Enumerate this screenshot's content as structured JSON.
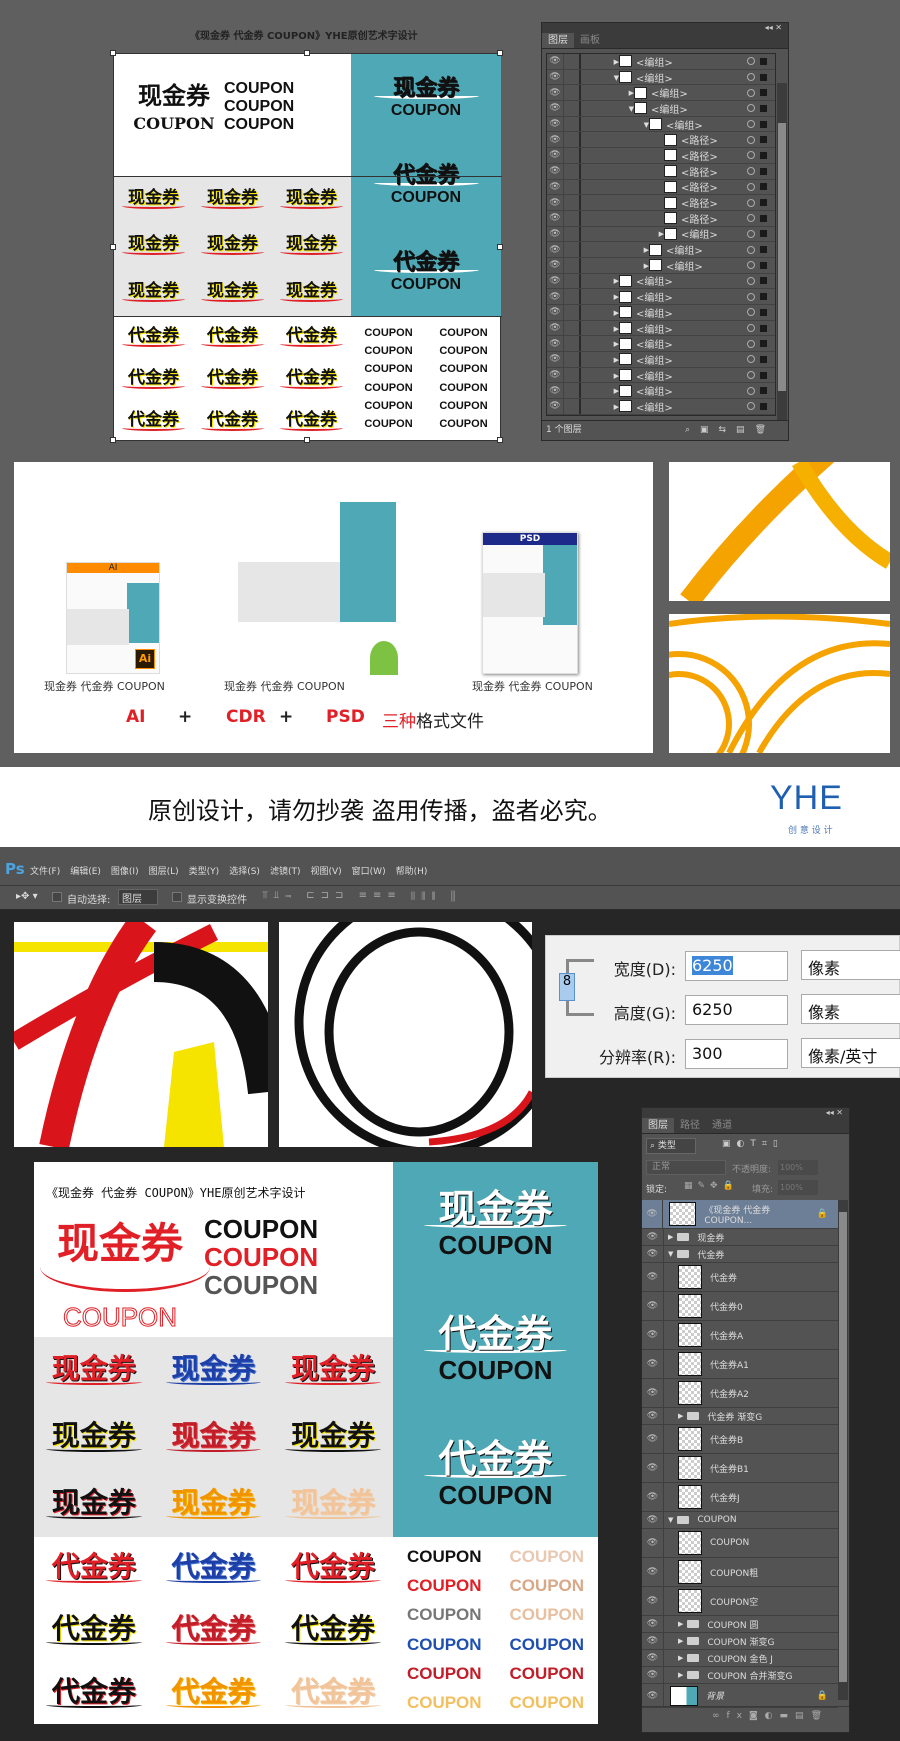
{
  "artboard": {
    "title": "《现金券 代金券 COUPON》YHE原创艺术字设计",
    "word_xian": "现金券",
    "word_dai": "代金券",
    "word_coupon": "COUPON",
    "teal": "#4fa8b5",
    "gray": "#e6e6e6"
  },
  "ai_layers": {
    "tabs": [
      "图层",
      "画板"
    ],
    "footer": "1 个图层",
    "rows": [
      {
        "indent": 0,
        "arrow": "▶",
        "label": "<编组>"
      },
      {
        "indent": 0,
        "arrow": "▼",
        "label": "<编组>"
      },
      {
        "indent": 1,
        "arrow": "▶",
        "label": "<编组>"
      },
      {
        "indent": 1,
        "arrow": "▼",
        "label": "<编组>"
      },
      {
        "indent": 2,
        "arrow": "▼",
        "label": "<编组>"
      },
      {
        "indent": 3,
        "arrow": "",
        "label": "<路径>"
      },
      {
        "indent": 3,
        "arrow": "",
        "label": "<路径>"
      },
      {
        "indent": 3,
        "arrow": "",
        "label": "<路径>"
      },
      {
        "indent": 3,
        "arrow": "",
        "label": "<路径>"
      },
      {
        "indent": 3,
        "arrow": "",
        "label": "<路径>"
      },
      {
        "indent": 3,
        "arrow": "",
        "label": "<路径>"
      },
      {
        "indent": 3,
        "arrow": "▶",
        "label": "<编组>"
      },
      {
        "indent": 2,
        "arrow": "▶",
        "label": "<编组>"
      },
      {
        "indent": 2,
        "arrow": "▶",
        "label": "<编组>"
      },
      {
        "indent": 0,
        "arrow": "▶",
        "label": "<编组>"
      },
      {
        "indent": 0,
        "arrow": "▶",
        "label": "<编组>"
      },
      {
        "indent": 0,
        "arrow": "▶",
        "label": "<编组>"
      },
      {
        "indent": 0,
        "arrow": "▶",
        "label": "<编组>"
      },
      {
        "indent": 0,
        "arrow": "▶",
        "label": "<编组>"
      },
      {
        "indent": 0,
        "arrow": "▶",
        "label": "<编组>"
      },
      {
        "indent": 0,
        "arrow": "▶",
        "label": "<编组>"
      },
      {
        "indent": 0,
        "arrow": "▶",
        "label": "<编组>"
      },
      {
        "indent": 0,
        "arrow": "▶",
        "label": "<编组>"
      }
    ]
  },
  "formats": {
    "caption": "现金券 代金券 COUPON",
    "ai_badge": "AI",
    "psd_badge": "PSD",
    "ai_logo": "Ai",
    "row": {
      "ai": "AI",
      "plus": "+",
      "cdr": "CDR",
      "psd": "PSD",
      "three": "三种",
      "rest": "格式文件"
    },
    "ai_color": "#ff8c00",
    "psd_color": "#1e2a8a",
    "red": "#e01f26"
  },
  "banner": {
    "text": "原创设计，请勿抄袭 盗用传播，盗者必究。",
    "logo": "YHE",
    "logo_sub": "创 意 设 计"
  },
  "photoshop": {
    "logo": "Ps",
    "menu": [
      "文件(F)",
      "编辑(E)",
      "图像(I)",
      "图层(L)",
      "类型(Y)",
      "选择(S)",
      "滤镜(T)",
      "视图(V)",
      "窗口(W)",
      "帮助(H)"
    ],
    "auto_select_label": "自动选择:",
    "auto_select_value": "图层",
    "show_transform_label": "显示变换控件"
  },
  "image_size": {
    "width_label": "宽度(D):",
    "width_value": "6250",
    "width_unit": "像素",
    "height_label": "高度(G):",
    "height_value": "6250",
    "height_unit": "像素",
    "res_label": "分辨率(R):",
    "res_value": "300",
    "res_unit": "像素/英寸"
  },
  "ps_layers": {
    "tabs": [
      "图层",
      "路径",
      "通道"
    ],
    "filter": "类型",
    "blend": "正常",
    "opacity_label": "不透明度:",
    "opacity": "100%",
    "lock_label": "锁定:",
    "fill_label": "填充:",
    "fill": "100%",
    "rows": [
      {
        "type": "layer",
        "indent": 0,
        "label": "《现金券 代金券 COUPON...",
        "selected": true,
        "locked": true
      },
      {
        "type": "folder",
        "indent": 0,
        "arrow": "▶",
        "label": "现金券"
      },
      {
        "type": "folder",
        "indent": 0,
        "arrow": "▼",
        "label": "代金券"
      },
      {
        "type": "layer",
        "indent": 1,
        "label": "代金券"
      },
      {
        "type": "layer",
        "indent": 1,
        "label": "代金券0"
      },
      {
        "type": "layer",
        "indent": 1,
        "label": "代金券A"
      },
      {
        "type": "layer",
        "indent": 1,
        "label": "代金券A1"
      },
      {
        "type": "layer",
        "indent": 1,
        "label": "代金券A2"
      },
      {
        "type": "folder",
        "indent": 1,
        "arrow": "▶",
        "label": "代金券 渐变G"
      },
      {
        "type": "layer",
        "indent": 1,
        "label": "代金券B"
      },
      {
        "type": "layer",
        "indent": 1,
        "label": "代金券B1"
      },
      {
        "type": "layer",
        "indent": 1,
        "label": "代金券J"
      },
      {
        "type": "folder",
        "indent": 0,
        "arrow": "▼",
        "label": "COUPON"
      },
      {
        "type": "layer",
        "indent": 1,
        "label": "COUPON"
      },
      {
        "type": "layer",
        "indent": 1,
        "label": "COUPON粗"
      },
      {
        "type": "layer",
        "indent": 1,
        "label": "COUPON空"
      },
      {
        "type": "folder",
        "indent": 1,
        "arrow": "▶",
        "label": "COUPON 圆"
      },
      {
        "type": "folder",
        "indent": 1,
        "arrow": "▶",
        "label": "COUPON 渐变G"
      },
      {
        "type": "folder",
        "indent": 1,
        "arrow": "▶",
        "label": "COUPON 金色 J"
      },
      {
        "type": "folder",
        "indent": 1,
        "arrow": "▶",
        "label": "COUPON 合并渐变G"
      },
      {
        "type": "background",
        "indent": 0,
        "label": "背景",
        "locked": true
      }
    ]
  },
  "artwork_colors": {
    "gray_xian": [
      [
        "#e01f26",
        "#111"
      ],
      [
        "#1f3fa8",
        "#3c6fd0"
      ],
      [
        "#e01f26",
        "#111"
      ],
      [
        "#111",
        "#f5e400"
      ],
      [
        "#c21e2a",
        "#e04040"
      ],
      [
        "#111",
        "#f5e400"
      ],
      [
        "#111",
        "#e01f26"
      ],
      [
        "#f29400",
        "#f6b400"
      ],
      [
        "#f2c49a",
        "#f0d0b0"
      ]
    ],
    "white_dai": [
      [
        "#e01f26",
        "#111"
      ],
      [
        "#1f3fa8",
        "#3c6fd0"
      ],
      [
        "#e01f26",
        "#111"
      ],
      [
        "#111",
        "#f5e400"
      ],
      [
        "#c21e2a",
        "#e04040"
      ],
      [
        "#111",
        "#f5e400"
      ],
      [
        "#111",
        "#e01f26"
      ],
      [
        "#f29400",
        "#f6b400"
      ],
      [
        "#f2c49a",
        "#f0d0b0"
      ]
    ],
    "coupon_grid": [
      "#111",
      "#e8c8b0",
      "#e01f26",
      "#d8a888",
      "#777",
      "#e8c0a0",
      "#1f4fb0",
      "#1f4fb0",
      "#c21e2a",
      "#c21e2a",
      "#f2c060",
      "#f2c060"
    ]
  }
}
